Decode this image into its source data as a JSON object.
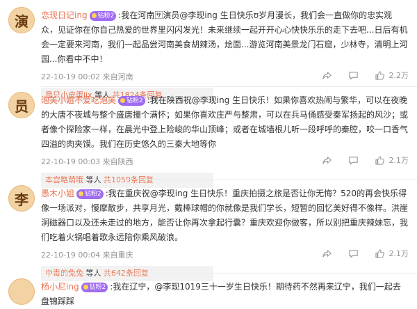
{
  "comments": [
    {
      "avatar": "演",
      "username": "恋现日记ing",
      "badge": "钻粉2",
      "text": ":我在河南🈂演员@李现ing 生日快乐ʊ岁月漫长，我们会一直做你的忠实观众，见证你在你自己热爱的世界里闪闪发光！未来继续一起开开心心快快乐乐的走下去吧...日后有机会一定要来河南，我们一起品尝河南美食胡辣汤，烩面...游览河南美景龙门石窟，少林寺，清明上河园...你看中不中！",
      "meta": "22-10-19 00:02  来自河南",
      "likes": "2.2万",
      "replier": "是只小皮蛋iix",
      "reply_mid": "等人",
      "reply_count": "共1824条回复"
    },
    {
      "avatar": "员",
      "username": "泡芙小姐不爱吃泡芙",
      "badge": "钻粉2",
      "text": ":我在陕西祝@李现ing 生日快乐！如果你喜欢热闹与繁华，可以在夜晚的大唐不夜城与整个盛唐撞个满怀；如果你喜欢庄严与整肃，可以在兵马俑感受秦军扬起的风沙；或者像个探险家一样，在晨光中登上险峻的华山顶峰；或者在城墙根儿听一段呼呼的秦腔，咬一口香气四溢的肉夹馍。我们在历史悠久的三秦大地等你",
      "meta": "22-10-19 00:03  来自陕西",
      "likes": "2.1万",
      "replier": "本宫略萌哦",
      "reply_mid": "等人",
      "reply_count": "共1059条回复"
    },
    {
      "avatar": "李",
      "username": "愚木小姐",
      "badge": "钻粉2",
      "text": ":我在重庆祝@李现ing 生日快乐！重庆拍摄之旅是否让你无悔？520的再会快乐得像一场派对，慢摩散步，共享月光，戴棒球帽的你就像是我们学长，短暂的回忆美好得不像样。洪崖洞磁器口以及还未走过的地方，能否让你再次拿起行囊？重庆欢迎你做客，所以别把重庆辣妹忘，我们吃着火锅唱着歌永远陪你乘风破浪。",
      "meta": "22-10-19 00:04  来自重庆",
      "likes": "2.1万",
      "replier": "中毒的兔兔",
      "reply_mid": "等人",
      "reply_count": "共642条回复"
    },
    {
      "username": "杨小尼ing",
      "badge": "钻粉2",
      "text": ":我在辽宁，@李现1019三十一岁生日快乐！期待药不然再来辽宁，我们一起去盘锦踩踩"
    }
  ]
}
